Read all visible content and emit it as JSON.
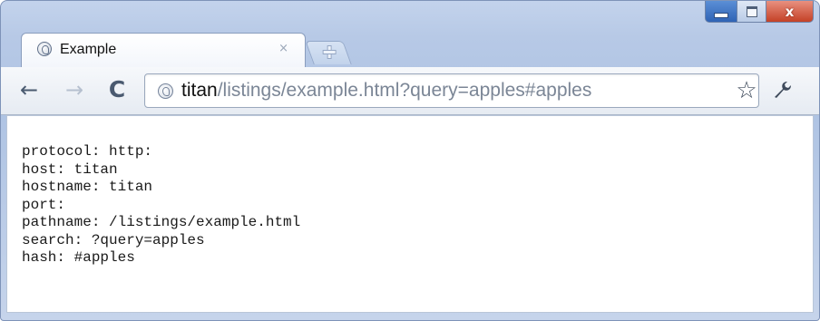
{
  "window": {
    "controls": {
      "close_glyph": "x"
    }
  },
  "tab": {
    "title": "Example",
    "close_glyph": "×",
    "icon": "globe-icon"
  },
  "toolbar": {
    "back_glyph": "←",
    "forward_glyph": "→",
    "reload_glyph": "C",
    "star_glyph": "☆",
    "wrench_glyph": "🔧"
  },
  "address_bar": {
    "host": "titan",
    "rest": "/listings/example.html?query=apples#apples",
    "icon": "globe-icon"
  },
  "page": {
    "lines": [
      "protocol: http:",
      "host: titan",
      "hostname: titan",
      "port:",
      "pathname: /listings/example.html",
      "search: ?query=apples",
      "hash: #apples"
    ]
  }
}
